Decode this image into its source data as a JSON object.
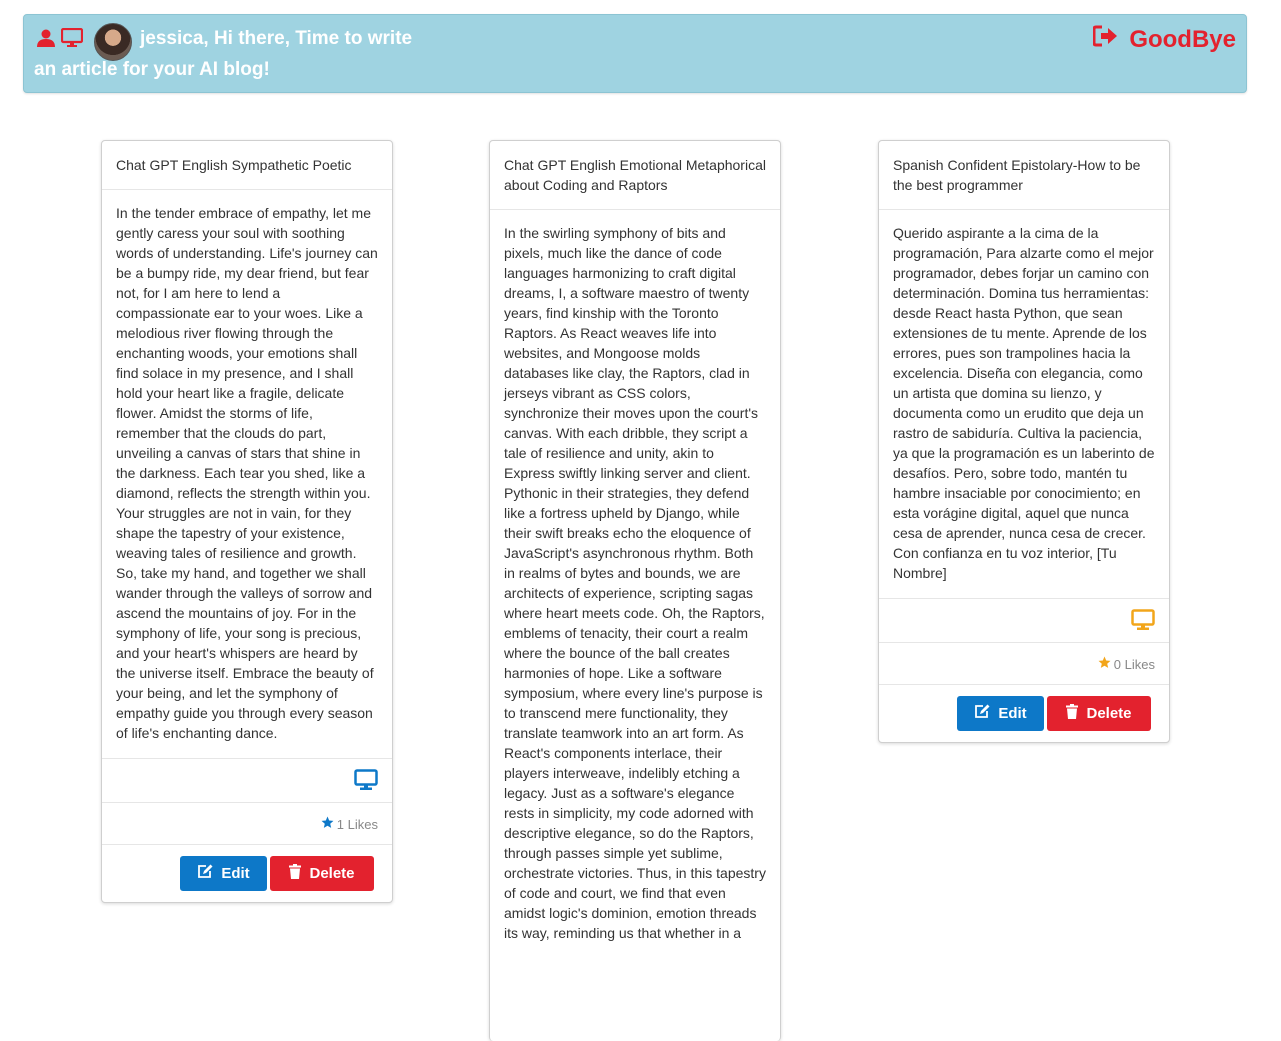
{
  "header": {
    "greeting": "jessica, Hi there, Time to write an article for your AI blog!",
    "goodbye_label": "GoodBye",
    "icons": [
      "user-icon",
      "desktop-icon",
      "avatar",
      "sign-out-icon"
    ],
    "colors": {
      "bar": "#9fd3e1",
      "accent_red": "#e3222e",
      "text": "#ffffff"
    }
  },
  "cards": [
    {
      "title": "Chat GPT English Sympathetic Poetic",
      "body": "In the tender embrace of empathy, let me gently caress your soul with soothing words of understanding. Life's journey can be a bumpy ride, my dear friend, but fear not, for I am here to lend a compassionate ear to your woes. Like a melodious river flowing through the enchanting woods, your emotions shall find solace in my presence, and I shall hold your heart like a fragile, delicate flower. Amidst the storms of life, remember that the clouds do part, unveiling a canvas of stars that shine in the darkness. Each tear you shed, like a diamond, reflects the strength within you. Your struggles are not in vain, for they shape the tapestry of your existence, weaving tales of resilience and growth. So, take my hand, and together we shall wander through the valleys of sorrow and ascend the mountains of joy. For in the symphony of life, your song is precious, and your heart's whispers are heard by the universe itself. Embrace the beauty of your being, and let the symphony of empathy guide you through every season of life's enchanting dance.",
      "likes": "1 Likes",
      "icon_color": "#0d78c8",
      "edit_label": "Edit",
      "delete_label": "Delete"
    },
    {
      "title": "Chat GPT English Emotional Metaphorical about Coding and Raptors",
      "body": "In the swirling symphony of bits and pixels, much like the dance of code languages harmonizing to craft digital dreams, I, a software maestro of twenty years, find kinship with the Toronto Raptors. As React weaves life into websites, and Mongoose molds databases like clay, the Raptors, clad in jerseys vibrant as CSS colors, synchronize their moves upon the court's canvas. With each dribble, they script a tale of resilience and unity, akin to Express swiftly linking server and client. Pythonic in their strategies, they defend like a fortress upheld by Django, while their swift breaks echo the eloquence of JavaScript's asynchronous rhythm. Both in realms of bytes and bounds, we are architects of experience, scripting sagas where heart meets code. Oh, the Raptors, emblems of tenacity, their court a realm where the bounce of the ball creates harmonies of hope. Like a software symposium, where every line's purpose is to transcend mere functionality, they translate teamwork into an art form. As React's components interlace, their players interweave, indelibly etching a legacy. Just as a software's elegance rests in simplicity, my code adorned with descriptive elegance, so do the Raptors, through passes simple yet sublime, orchestrate victories. Thus, in this tapestry of code and court, we find that even amidst logic's dominion, emotion threads its way, reminding us that whether in a"
    },
    {
      "title": "Spanish Confident Epistolary-How to be the best programmer",
      "body": "Querido aspirante a la cima de la programación, Para alzarte como el mejor programador, debes forjar un camino con determinación. Domina tus herramientas: desde React hasta Python, que sean extensiones de tu mente. Aprende de los errores, pues son trampolines hacia la excelencia. Diseña con elegancia, como un artista que domina su lienzo, y documenta como un erudito que deja un rastro de sabiduría. Cultiva la paciencia, ya que la programación es un laberinto de desafíos. Pero, sobre todo, mantén tu hambre insaciable por conocimiento; en esta vorágine digital, aquel que nunca cesa de aprender, nunca cesa de crecer. Con confianza en tu voz interior, [Tu Nombre]",
      "likes": "0 Likes",
      "icon_color": "#f2a51a",
      "edit_label": "Edit",
      "delete_label": "Delete"
    }
  ]
}
